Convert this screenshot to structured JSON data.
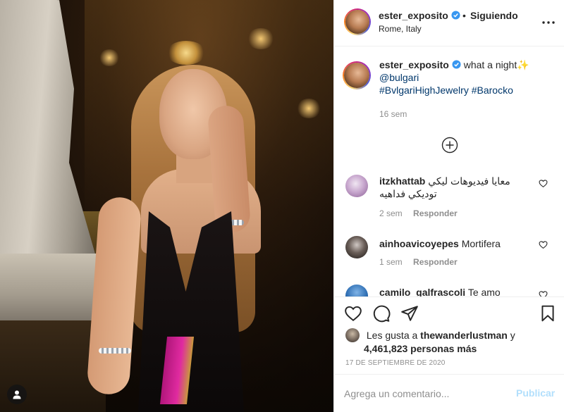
{
  "post": {
    "username": "ester_exposito",
    "follow_status": "Siguiendo",
    "separator": "•",
    "location": "Rome, Italy"
  },
  "caption": {
    "username": "ester_exposito",
    "text": "what a night✨",
    "mention": "@bulgari",
    "hashtag1": "#BvlgariHighJewelry",
    "hashtag2": "#Barocko",
    "time": "16 sem"
  },
  "comments": [
    {
      "username": "itzkhattab",
      "text": "معايا فيديوهات ليكي توديكي فداهيه",
      "time": "2 sem",
      "reply": "Responder"
    },
    {
      "username": "ainhoavicoyepes",
      "text": "Mortifera",
      "time": "1 sem",
      "reply": "Responder"
    },
    {
      "username": "camilo_galfrascoli",
      "text": "Te amo",
      "time": "",
      "reply": ""
    }
  ],
  "likes": {
    "prefix": "Les gusta a",
    "user": "thewanderlustman",
    "conj": "y",
    "count": "4,461,823 personas más"
  },
  "date": "17 DE SEPTIEMBRE DE 2020",
  "add_comment": {
    "placeholder": "Agrega un comentario...",
    "publish": "Publicar"
  },
  "icons": {
    "verified": "verified-badge-icon",
    "more": "more-options-icon",
    "add": "load-more-comments-icon",
    "heart": "heart-icon",
    "comment": "comment-icon",
    "share": "share-icon",
    "save": "bookmark-icon",
    "user_tag": "user-tag-icon"
  },
  "colors": {
    "verified": "#3897f0",
    "link": "#00376b",
    "muted": "#8e8e8e",
    "publish_disabled": "#b2dffc",
    "border": "#efefef"
  }
}
